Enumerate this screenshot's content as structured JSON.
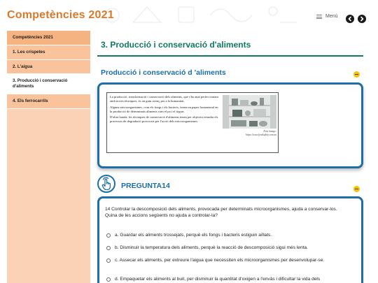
{
  "header": {
    "logo": "Competències 2021",
    "menu_label": "Menú",
    "prev_icon": "chevron-left-icon",
    "next_icon": "chevron-right-icon"
  },
  "sidebar": {
    "items": [
      {
        "label": "Competències 2021"
      },
      {
        "label": "1. Les crispetes"
      },
      {
        "label": "2. L'aigua"
      },
      {
        "label": "3. Producció i conservació d'aliments"
      },
      {
        "label": "4. Els ferrocarrils"
      }
    ],
    "active_index": 3
  },
  "main": {
    "page_title": "3. Producció i conservació d'aliments",
    "section_title": "Producció i conservació d 'aliments",
    "document": {
      "paragraphs": [
        "La producció, transformació i conservació dels aliments, que s'ha anat perfeccionant amb noves tècniques, és un gran avenç per a la humanitat.",
        "Alguns microorganismes, com els fongs i els bacteris, tenen un paper fonamental en la producció de determinats aliments com el pa i el iogurt.",
        "D'altra banda, les tècniques de conservació d'aliments tenen per objectiu retardar els processos de degradació provocats per l'acció dels microorganismes."
      ],
      "caption_line1": "Font imatge:",
      "caption_line2": "https://www.foodsafety.com.au"
    },
    "question": {
      "title": "PREGUNTA14",
      "text_line1": "14 Controlar la descomposició dels aliments, provocada per determinats microorganismes, ajuda a conservar-los.",
      "text_line2": "Quina de les accions següents no ajuda a controlar-la?",
      "options": [
        {
          "label": "a. Guardar els aliments trossejats, perquè els fongs i bacteris estiguin aïllats."
        },
        {
          "label": "b. Disminuir la temperatura dels aliments, perquè la reacció de descomposició sigui més lenta."
        },
        {
          "label": "c. Assecar els aliments, per extreure l'aigua que necessiten els microorganismes per desenvolupar-se."
        },
        {
          "label": "d. Empaquetar els aliments al buit, per disminuir la quantitat d'oxigen a l'envàs i dificultar la vida dels microorganismes."
        }
      ]
    }
  },
  "colors": {
    "brand_orange": "#d9792b",
    "title_green": "#0f7a5f",
    "accent_blue": "#1d6fa5",
    "sidebar_peach": "#fbc39b",
    "toggle_yellow": "#f3c112"
  }
}
